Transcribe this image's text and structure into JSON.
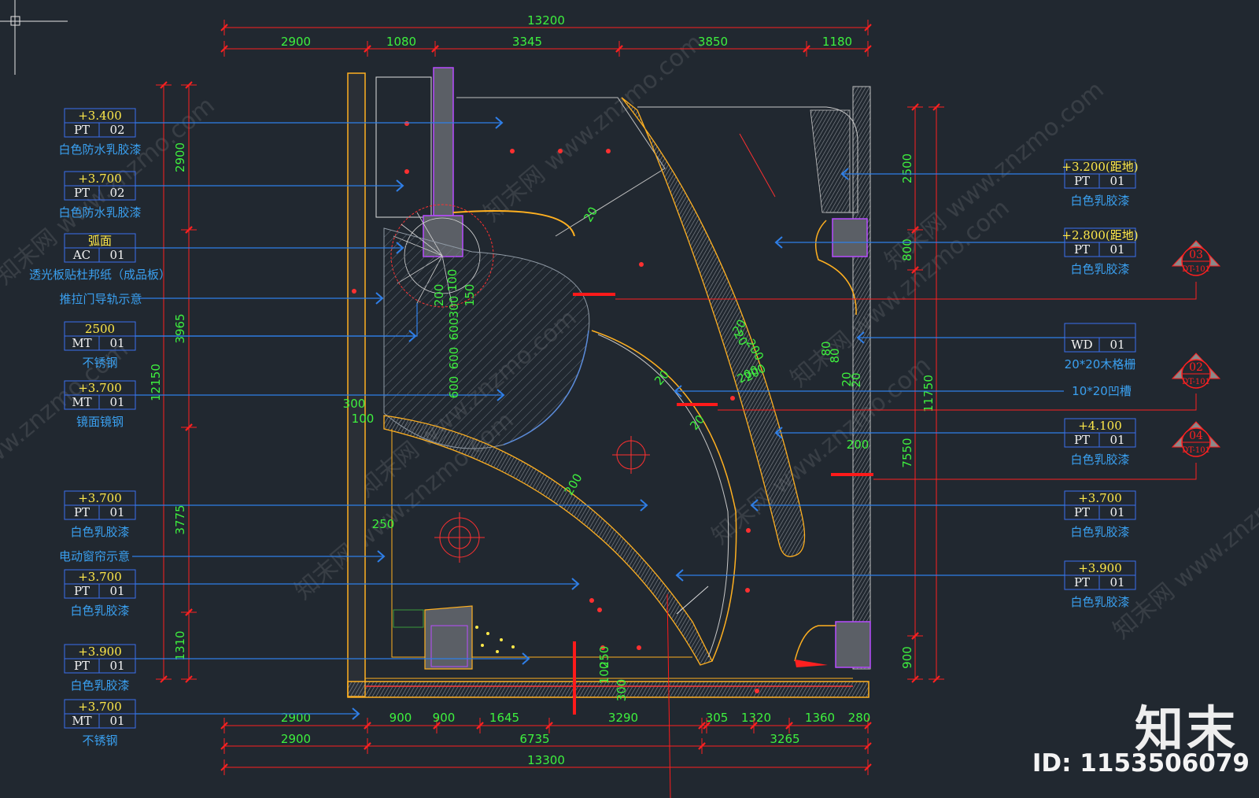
{
  "watermark": "知末网 www.znzmo.com",
  "brand": {
    "name": "知末",
    "id_text": "ID: 1153506079"
  },
  "dims_top": {
    "total": "13200",
    "segments": [
      "2900",
      "1080",
      "3345",
      "3850",
      "1180"
    ]
  },
  "dims_bottom": {
    "row1": [
      "2900",
      "900",
      "900",
      "1645",
      "3290",
      "305",
      "1320",
      "1360",
      "280"
    ],
    "row2": [
      "2900",
      "6735",
      "3265"
    ],
    "total": "13300"
  },
  "dims_left": {
    "total": "12150",
    "segments": [
      "2900",
      "3965",
      "3775",
      "1310"
    ]
  },
  "dims_right": {
    "total": "11750",
    "segments": [
      "2500",
      "800",
      "7550",
      "900"
    ]
  },
  "inner_dims": [
    "300",
    "100",
    "250",
    "200",
    "150",
    "300",
    "100",
    "600",
    "600",
    "600",
    "20",
    "200",
    "20",
    "20",
    "200",
    "20",
    "80",
    "80",
    "20",
    "20",
    "200",
    "200",
    "100",
    "250",
    "300",
    "200",
    "20"
  ],
  "left_tags": [
    {
      "elev": "+3.400",
      "code": "PT",
      "num": "02",
      "desc": "白色防水乳胶漆"
    },
    {
      "elev": "+3.700",
      "code": "PT",
      "num": "02",
      "desc": "白色防水乳胶漆"
    },
    {
      "elev": "弧面",
      "code": "AC",
      "num": "01",
      "desc": "透光板贴杜邦纸（成品板）"
    },
    {
      "elev": "2500",
      "code": "MT",
      "num": "01",
      "desc": "不锈钢"
    },
    {
      "elev": "+3.700",
      "code": "MT",
      "num": "01",
      "desc": "镜面镜钢"
    },
    {
      "elev": "+3.700",
      "code": "PT",
      "num": "01",
      "desc": "白色乳胶漆"
    },
    {
      "elev": "+3.700",
      "code": "PT",
      "num": "01",
      "desc": "白色乳胶漆"
    },
    {
      "elev": "+3.900",
      "code": "PT",
      "num": "01",
      "desc": "白色乳胶漆"
    },
    {
      "elev": "+3.700",
      "code": "MT",
      "num": "01",
      "desc": "不锈钢"
    }
  ],
  "left_notes": [
    "推拉门导轨示意",
    "电动窗帘示意"
  ],
  "right_tags": [
    {
      "elev": "+3.200(距地)",
      "code": "PT",
      "num": "01",
      "desc": "白色乳胶漆"
    },
    {
      "elev": "+2.800(距地)",
      "code": "PT",
      "num": "01",
      "desc": "白色乳胶漆"
    },
    {
      "elev": "",
      "code": "WD",
      "num": "01",
      "desc": "20*20木格栅"
    },
    {
      "elev": "+4.100",
      "code": "PT",
      "num": "01",
      "desc": "白色乳胶漆"
    },
    {
      "elev": "+3.700",
      "code": "PT",
      "num": "01",
      "desc": "白色乳胶漆"
    },
    {
      "elev": "+3.900",
      "code": "PT",
      "num": "01",
      "desc": "白色乳胶漆"
    }
  ],
  "right_notes": [
    "10*20凹槽"
  ],
  "section_markers": [
    {
      "num": "03",
      "sheet": "DT-101"
    },
    {
      "num": "02",
      "sheet": "DT-101"
    },
    {
      "num": "04",
      "sheet": "DT-101"
    }
  ],
  "colors": {
    "background": "#212830",
    "dimension": "#ff2020",
    "dimension_text": "#3ef03e",
    "leader": "#2f7fe8",
    "tag_line": "#3a6ff0",
    "tag_text": "#f4f4f4",
    "elev_text": "#ffe94a",
    "wall": "#ffb020"
  }
}
